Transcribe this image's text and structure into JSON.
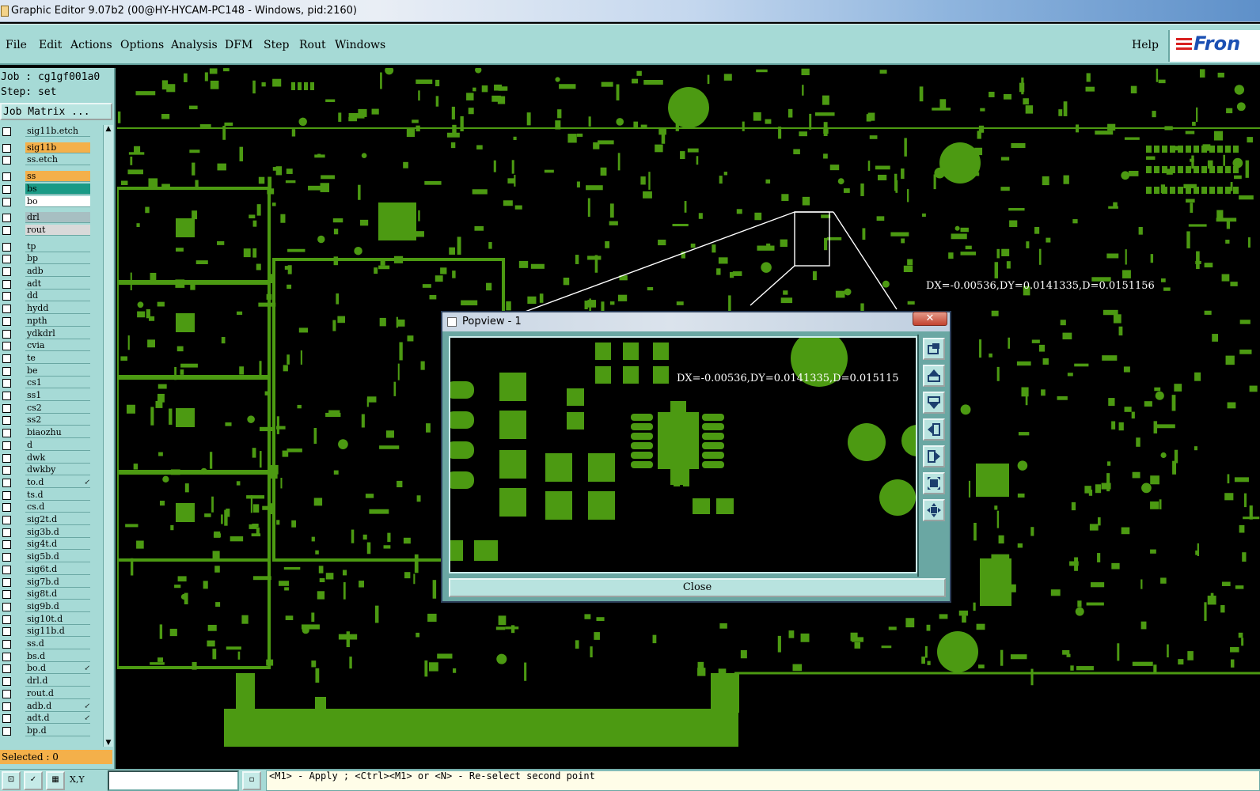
{
  "window": {
    "title": "Graphic Editor 9.07b2 (00@HY-HYCAM-PC148 - Windows, pid:2160)"
  },
  "menu": {
    "items": [
      "File",
      "Edit",
      "Actions",
      "Options",
      "Analysis",
      "DFM",
      "Step",
      "Rout",
      "Windows"
    ],
    "help": "Help",
    "logo_text": "Fron"
  },
  "job": {
    "job_label": "Job : cg1gf001a0",
    "step_label": "Step: set",
    "matrix_button": "Job Matrix ..."
  },
  "layers": [
    {
      "name": "sig11b.etch",
      "color": "#a6dad6"
    },
    {
      "name": "sig11b",
      "color": "#f4b04a"
    },
    {
      "name": "ss.etch",
      "color": "#a6dad6"
    },
    {
      "name": "ss",
      "color": "#f4b04a"
    },
    {
      "name": "bs",
      "color": "#1a9a86"
    },
    {
      "name": "bo",
      "color": "#ffffff"
    },
    {
      "name": "drl",
      "color": "#a7bfc2"
    },
    {
      "name": "rout",
      "color": "#d9d9d9"
    },
    {
      "name": "tp",
      "color": "#a6dad6"
    },
    {
      "name": "bp",
      "color": "#a6dad6"
    },
    {
      "name": "adb",
      "color": "#a6dad6"
    },
    {
      "name": "adt",
      "color": "#a6dad6"
    },
    {
      "name": "dd",
      "color": "#a6dad6"
    },
    {
      "name": "hydd",
      "color": "#a6dad6"
    },
    {
      "name": "npth",
      "color": "#a6dad6"
    },
    {
      "name": "ydkdrl",
      "color": "#a6dad6"
    },
    {
      "name": "cvia",
      "color": "#a6dad6"
    },
    {
      "name": "te",
      "color": "#a6dad6"
    },
    {
      "name": "be",
      "color": "#a6dad6"
    },
    {
      "name": "cs1",
      "color": "#a6dad6"
    },
    {
      "name": "ss1",
      "color": "#a6dad6"
    },
    {
      "name": "cs2",
      "color": "#a6dad6"
    },
    {
      "name": "ss2",
      "color": "#a6dad6"
    },
    {
      "name": "biaozhu",
      "color": "#a6dad6"
    },
    {
      "name": "d",
      "color": "#a6dad6"
    },
    {
      "name": "dwk",
      "color": "#a6dad6"
    },
    {
      "name": "dwkby",
      "color": "#a6dad6"
    },
    {
      "name": "to.d",
      "color": "#a6dad6",
      "arrow": true
    },
    {
      "name": "ts.d",
      "color": "#a6dad6"
    },
    {
      "name": "cs.d",
      "color": "#a6dad6"
    },
    {
      "name": "sig2t.d",
      "color": "#a6dad6"
    },
    {
      "name": "sig3b.d",
      "color": "#a6dad6"
    },
    {
      "name": "sig4t.d",
      "color": "#a6dad6"
    },
    {
      "name": "sig5b.d",
      "color": "#a6dad6"
    },
    {
      "name": "sig6t.d",
      "color": "#a6dad6"
    },
    {
      "name": "sig7b.d",
      "color": "#a6dad6"
    },
    {
      "name": "sig8t.d",
      "color": "#a6dad6"
    },
    {
      "name": "sig9b.d",
      "color": "#a6dad6"
    },
    {
      "name": "sig10t.d",
      "color": "#a6dad6"
    },
    {
      "name": "sig11b.d",
      "color": "#a6dad6"
    },
    {
      "name": "ss.d",
      "color": "#a6dad6"
    },
    {
      "name": "bs.d",
      "color": "#a6dad6"
    },
    {
      "name": "bo.d",
      "color": "#a6dad6",
      "arrow": true
    },
    {
      "name": "drl.d",
      "color": "#a6dad6"
    },
    {
      "name": "rout.d",
      "color": "#a6dad6"
    },
    {
      "name": "adb.d",
      "color": "#a6dad6",
      "arrow": true
    },
    {
      "name": "adt.d",
      "color": "#a6dad6",
      "arrow": true
    },
    {
      "name": "bp.d",
      "color": "#a6dad6"
    }
  ],
  "selected_label": "Selected : 0",
  "canvas": {
    "measure_text": "DX=-0.00536,DY=0.0141335,D=0.0151156",
    "copper_color": "#4c9a12"
  },
  "popview": {
    "title": "Popview - 1",
    "measure_text": "DX=-0.00536,DY=0.0141335,D=0.015115",
    "close_label": "Close",
    "tool_icons": [
      "zoom-fit-icon",
      "zoom-in-icon",
      "zoom-out-icon",
      "pan-left-icon",
      "pan-right-icon",
      "zoom-area-icon",
      "center-icon"
    ]
  },
  "status": {
    "xy_label": "X,Y",
    "prompt": "<M1> - Apply  ; <Ctrl><M1> or <N> - Re-select second point"
  }
}
